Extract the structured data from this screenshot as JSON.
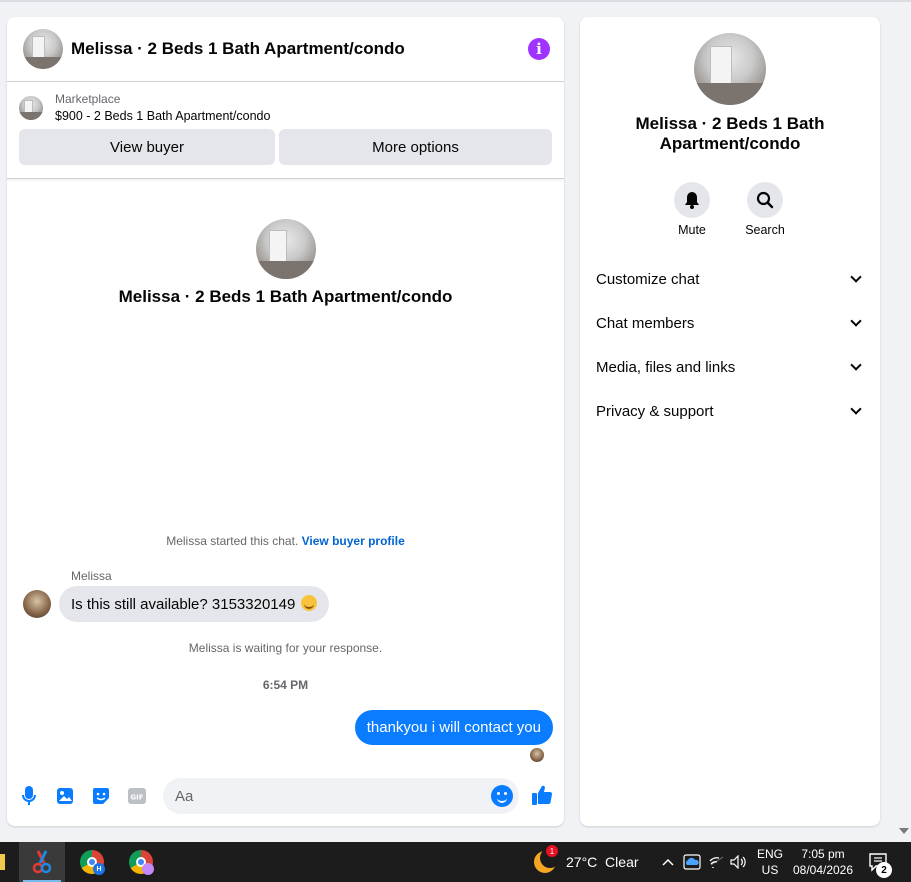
{
  "chat": {
    "title": "Melissa · 2 Beds 1 Bath Apartment/condo",
    "marketplace": {
      "label": "Marketplace",
      "listing": "$900 - 2 Beds 1 Bath Apartment/condo",
      "view_buyer_label": "View buyer",
      "more_options_label": "More options"
    },
    "intro_name": "Melissa · 2 Beds 1 Bath Apartment/condo",
    "started_text": "Melissa started this chat.",
    "view_profile_link": "View buyer profile",
    "sender_name": "Melissa",
    "incoming_message": "Is this still available? 3153320149",
    "waiting_text": "Melissa is waiting for your response.",
    "timestamp": "6:54 PM",
    "outgoing_message": "thankyou i will contact you",
    "input_placeholder": "Aa"
  },
  "panel": {
    "name": "Melissa · 2 Beds 1 Bath Apartment/condo",
    "mute_label": "Mute",
    "search_label": "Search",
    "sections": [
      "Customize chat",
      "Chat members",
      "Media, files and links",
      "Privacy & support"
    ]
  },
  "taskbar": {
    "weather": "27°C  Clear",
    "weather_badge": "1",
    "lang_top": "ENG",
    "lang_bottom": "US",
    "time": "7:05 pm",
    "date": "08/04/2026",
    "notification_count": "2",
    "chrome_badge_1": "H"
  },
  "colors": {
    "accent_blue": "#0a7cff",
    "info_purple": "#a033ff",
    "link_blue": "#0064d1"
  }
}
